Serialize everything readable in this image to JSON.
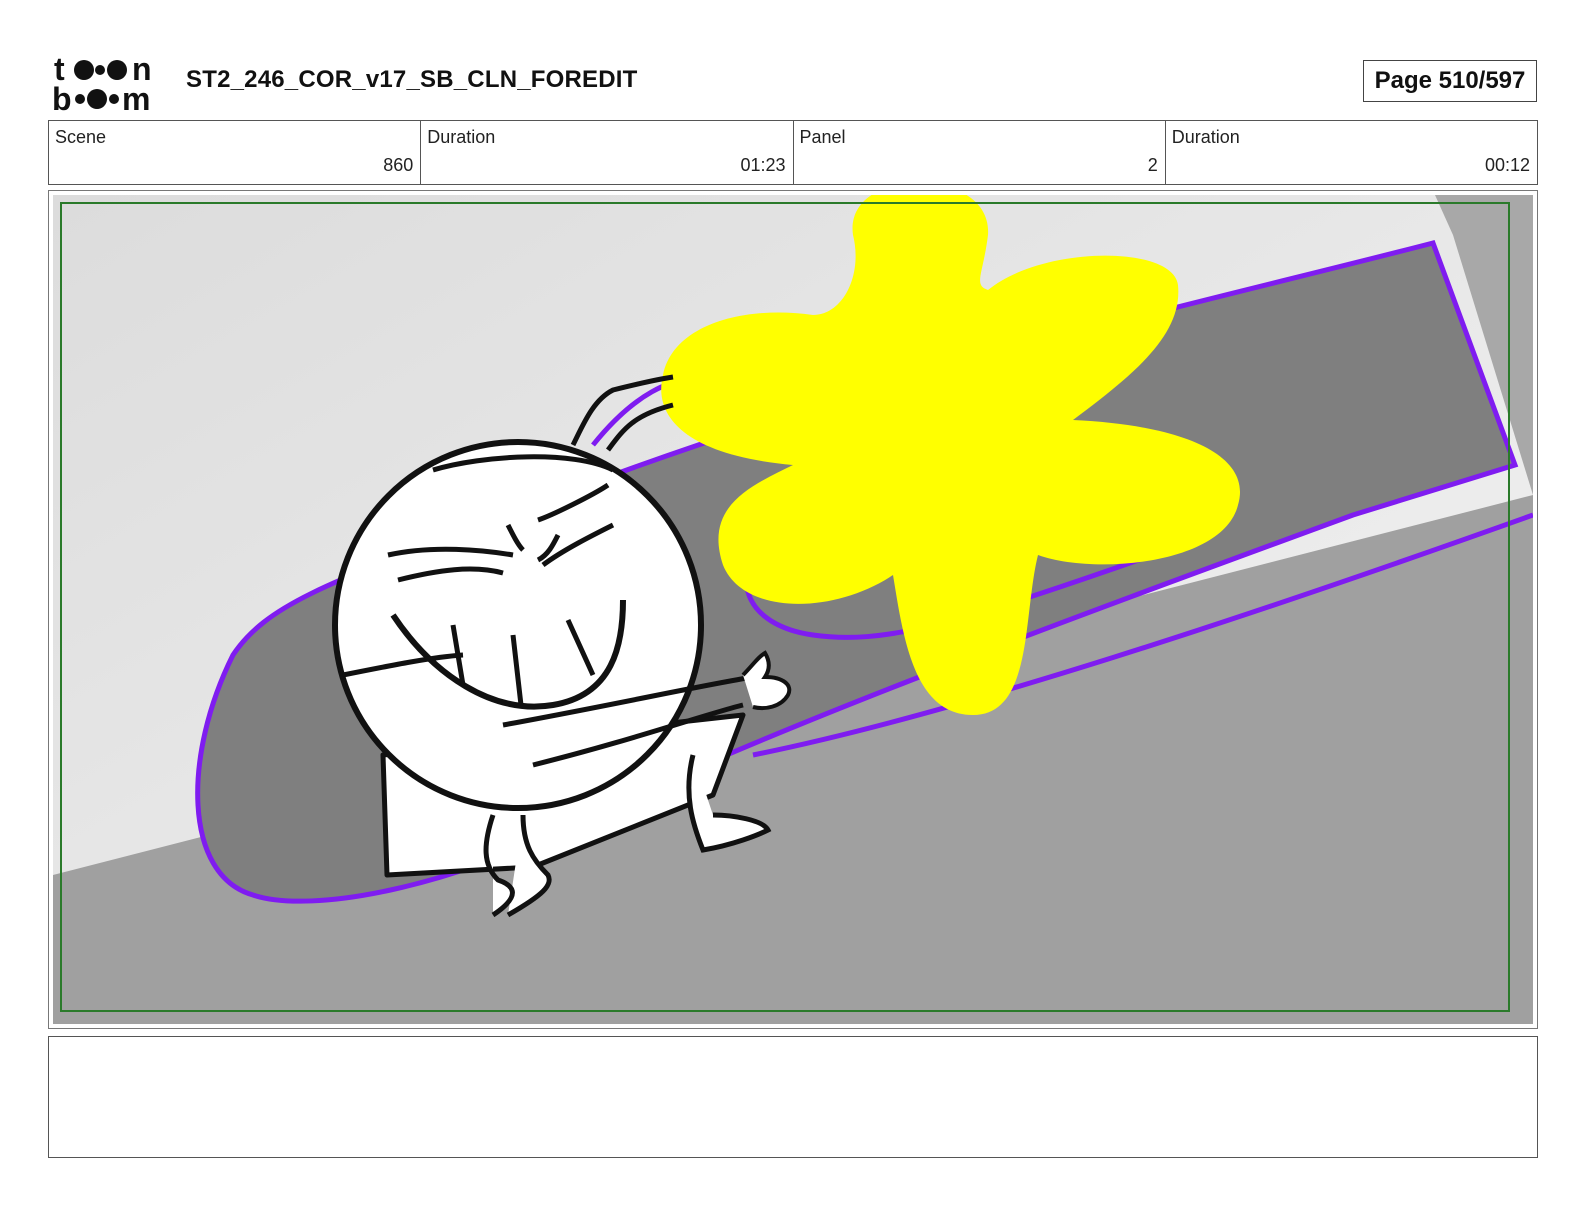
{
  "header": {
    "logo_text": "toon boom",
    "title": "ST2_246_COR_v17_SB_CLN_FOREDIT",
    "page_label": "Page 510/597"
  },
  "info": {
    "scene_label": "Scene",
    "scene_value": "860",
    "scene_duration_label": "Duration",
    "scene_duration_value": "01:23",
    "panel_label": "Panel",
    "panel_value": "2",
    "panel_duration_label": "Duration",
    "panel_duration_value": "00:12"
  },
  "panel": {
    "colors": {
      "wall": "#e8e8e8",
      "floor": "#a0a0a0",
      "slide": "#808080",
      "slide_outline": "#7f1cf0",
      "burst": "#ffff00",
      "safe_frame": "#2a7a2a"
    }
  },
  "caption": {
    "text": ""
  }
}
